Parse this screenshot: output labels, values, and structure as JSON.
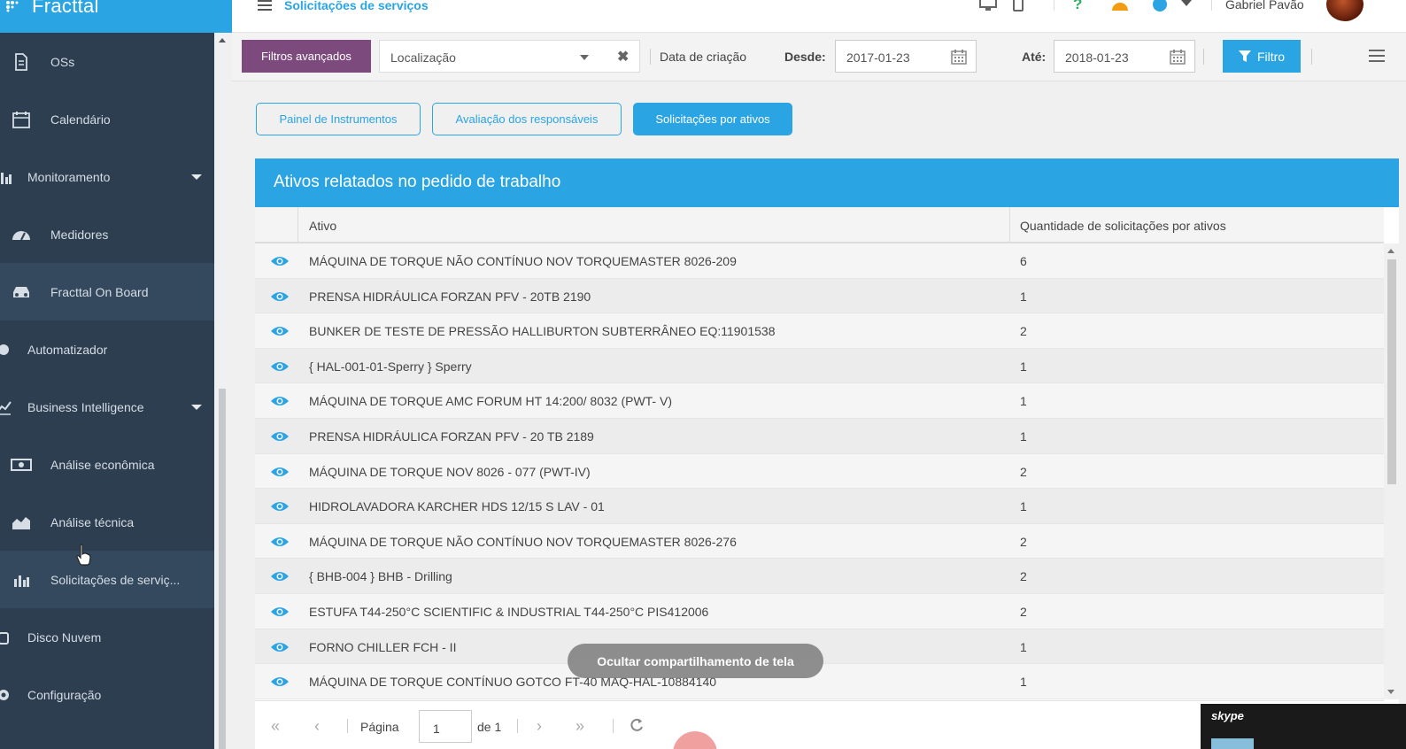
{
  "app": {
    "brand": "Fracttal"
  },
  "sidebar": {
    "items": [
      {
        "label": "OSs",
        "icon": "document-icon",
        "group": false,
        "caret": false,
        "active": false
      },
      {
        "label": "Calendário",
        "icon": "calendar-icon",
        "group": false,
        "caret": false,
        "active": false
      },
      {
        "label": "Monitoramento",
        "icon": "bar-chart-icon",
        "group": true,
        "caret": true,
        "active": false
      },
      {
        "label": "Medidores",
        "icon": "gauge-icon",
        "group": false,
        "caret": false,
        "active": false
      },
      {
        "label": "Fracttal On Board",
        "icon": "car-icon",
        "group": false,
        "caret": false,
        "active": true
      },
      {
        "label": "Automatizador",
        "icon": "circle-icon",
        "group": true,
        "caret": false,
        "active": false
      },
      {
        "label": "Business Intelligence",
        "icon": "line-chart-icon",
        "group": true,
        "caret": true,
        "active": false
      },
      {
        "label": "Análise econômica",
        "icon": "money-icon",
        "group": false,
        "caret": false,
        "active": false
      },
      {
        "label": "Análise técnica",
        "icon": "area-chart-icon",
        "group": false,
        "caret": false,
        "active": false
      },
      {
        "label": "Solicitações de serviç...",
        "icon": "bar-chart-icon",
        "group": false,
        "caret": false,
        "active": true
      },
      {
        "label": "Disco Nuvem",
        "icon": "cloud-icon",
        "group": true,
        "caret": false,
        "active": false
      },
      {
        "label": "Configuração",
        "icon": "gear-icon",
        "group": true,
        "caret": false,
        "active": false
      }
    ]
  },
  "header": {
    "title": "Solicitações de serviços",
    "user_name": "Gabriel Pavão"
  },
  "filters": {
    "advanced_label": "Filtros avançados",
    "location_value": "Localização",
    "date_type_label": "Data de criação",
    "from_label": "Desde:",
    "from_value": "2017-01-23",
    "to_label": "Até:",
    "to_value": "2018-01-23",
    "filter_button": "Filtro"
  },
  "tabs": [
    {
      "label": "Painel de Instrumentos",
      "active": false
    },
    {
      "label": "Avaliação dos responsáveis",
      "active": false
    },
    {
      "label": "Solicitações por ativos",
      "active": true
    }
  ],
  "panel": {
    "title": "Ativos relatados no pedido de trabalho",
    "columns": [
      "Ativo",
      "Quantidade de solicitações por ativos"
    ],
    "rows": [
      {
        "asset": "MÁQUINA DE TORQUE NÃO CONTÍNUO NOV TORQUEMASTER 8026-209",
        "qty": "6"
      },
      {
        "asset": "PRENSA HIDRÁULICA FORZAN PFV - 20TB 2190",
        "qty": "1"
      },
      {
        "asset": "BUNKER DE TESTE DE PRESSÃO HALLIBURTON SUBTERRÂNEO EQ:11901538",
        "qty": "2"
      },
      {
        "asset": "{ HAL-001-01-Sperry } Sperry",
        "qty": "1"
      },
      {
        "asset": "MÁQUINA DE TORQUE AMC FORUM HT 14:200/ 8032 (PWT- V)",
        "qty": "1"
      },
      {
        "asset": "PRENSA HIDRÁULICA FORZAN PFV - 20 TB 2189",
        "qty": "1"
      },
      {
        "asset": "MÁQUINA DE TORQUE NOV 8026 - 077 (PWT-IV)",
        "qty": "2"
      },
      {
        "asset": "HIDROLAVADORA KARCHER HDS 12/15 S LAV - 01",
        "qty": "1"
      },
      {
        "asset": "MÁQUINA DE TORQUE NÃO CONTÍNUO NOV TORQUEMASTER 8026-276",
        "qty": "2"
      },
      {
        "asset": "{ BHB-004 } BHB - Drilling",
        "qty": "2"
      },
      {
        "asset": "ESTUFA T44-250°C SCIENTIFIC & INDUSTRIAL T44-250°C PIS412006",
        "qty": "2"
      },
      {
        "asset": "FORNO CHILLER FCH - II",
        "qty": "1"
      },
      {
        "asset": "MÁQUINA DE TORQUE CONTÍNUO GOTCO FT-40 MAQ-HAL-10884140",
        "qty": "1"
      }
    ]
  },
  "pager": {
    "page_label": "Página",
    "page_value": "1",
    "of_label": "de 1"
  },
  "overlay": {
    "share_label": "Ocultar compartilhamento de tela",
    "skype_label": "skype"
  },
  "colors": {
    "brand": "#2aa4e3",
    "sidebar": "#2c3e50",
    "advanced_filter": "#7d4a7e"
  }
}
